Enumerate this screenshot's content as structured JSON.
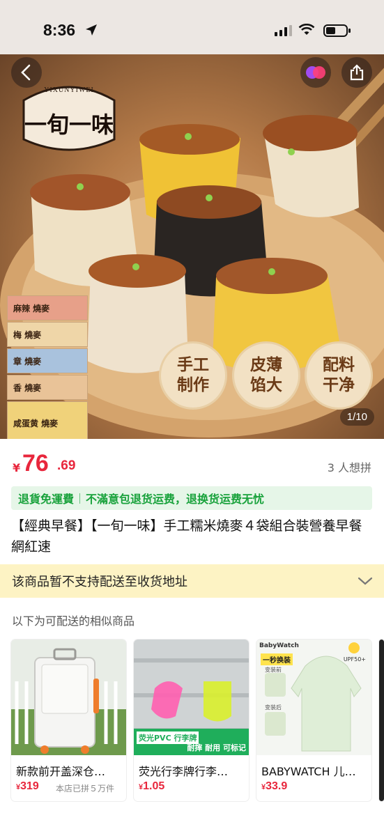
{
  "status_bar": {
    "time": "8:36"
  },
  "hero": {
    "brand_latin": "YIXUNYIWEI",
    "brand_name": "一旬一味",
    "badges": [
      "手工\n制作",
      "皮薄\n馅大",
      "配料\n干净"
    ],
    "packages": [
      "麻辣 燒麥",
      "梅 燒麥",
      "章 燒麥",
      "香 燒麥",
      "咸蛋黄 燒麥"
    ],
    "page_indicator": "1/10"
  },
  "price": {
    "currency": "¥",
    "integer": "76",
    "decimal": ".69",
    "want_count": "3 人想拼"
  },
  "promo": {
    "part1": "退貨免運費",
    "part2": "不滿意包退货运费，退换货运费无忧"
  },
  "product_title": "【經典早餐】【一旬一味】手工糯米燒麥４袋組合裝營養早餐網紅速",
  "notice": {
    "text": "该商品暂不支持配送至收货地址"
  },
  "section_label": "以下为可配送的相似商品",
  "recommendations": [
    {
      "title": "新款前开盖深仓…",
      "currency": "¥",
      "price": "319",
      "sold": "本店已拼５万件",
      "img_text": ""
    },
    {
      "title": "荧光行李牌行李…",
      "currency": "¥",
      "price": "1.05",
      "sold": "",
      "img_text": "荧光PVC 行李牌",
      "img_tags": "耐摔 耐用 可标记"
    },
    {
      "title": "BABYWATCH 儿…",
      "currency": "¥",
      "price": "33.9",
      "sold": "",
      "img_text": "一秒换装",
      "img_brand": "BabyWatch",
      "img_sub1": "变装前",
      "img_sub2": "变装后",
      "img_badge": "UPF50+"
    }
  ],
  "colors": {
    "accent_red": "#e8263c",
    "promo_green": "#19a23c",
    "notice_bg": "#fdf3c4"
  }
}
